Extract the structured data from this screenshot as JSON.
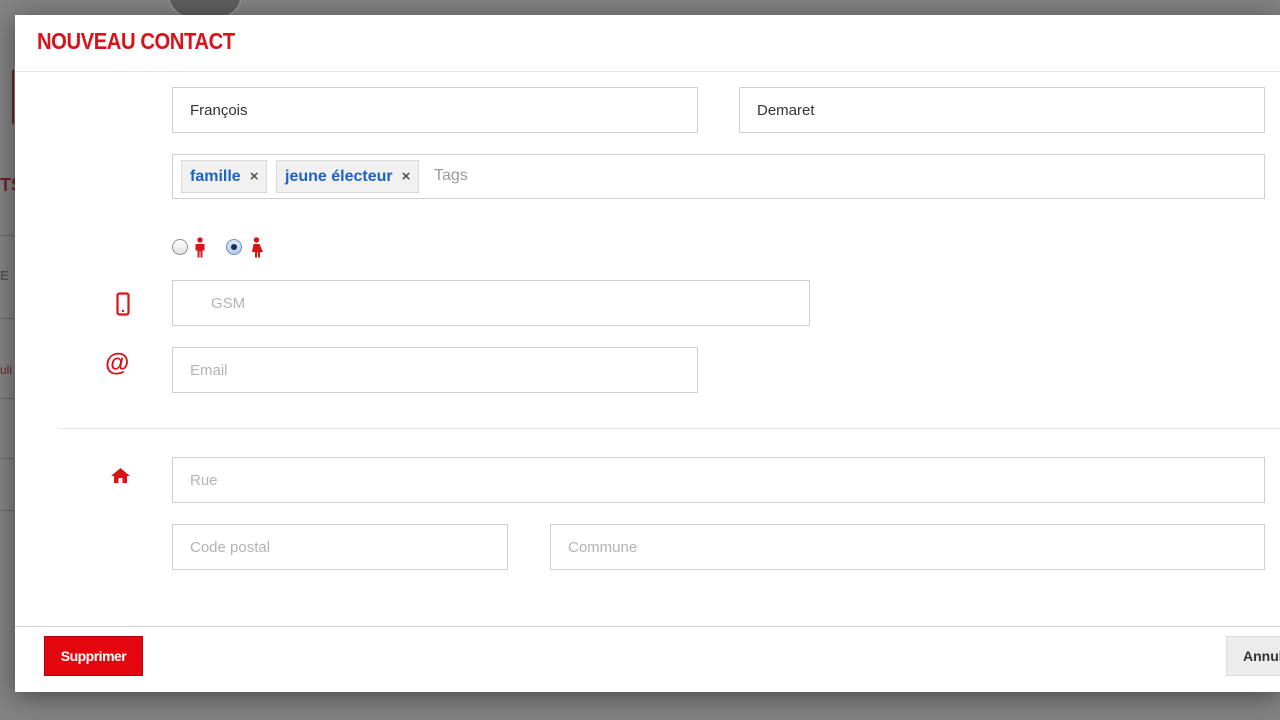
{
  "modal": {
    "title": "NOUVEAU CONTACT"
  },
  "form": {
    "first_name": {
      "value": "François"
    },
    "last_name": {
      "value": "Demaret"
    },
    "tags": {
      "items": [
        {
          "label": "famille"
        },
        {
          "label": "jeune électeur"
        }
      ],
      "remove_glyph": "×",
      "placeholder": "Tags"
    },
    "gender": {
      "options": [
        "male",
        "female"
      ],
      "selected": "female"
    },
    "gsm": {
      "placeholder": "GSM",
      "icon": "mobile-phone-icon"
    },
    "email": {
      "placeholder": "Email",
      "icon": "at-sign-icon",
      "glyph": "@"
    },
    "address": {
      "icon": "home-icon",
      "street": {
        "placeholder": "Rue"
      },
      "postal_code": {
        "placeholder": "Code postal"
      },
      "city": {
        "placeholder": "Commune"
      }
    }
  },
  "footer": {
    "delete_label": "Supprimer",
    "cancel_label": "Annuler"
  },
  "colors": {
    "accent": "#d8131a",
    "tag_text": "#1f62c0"
  }
}
